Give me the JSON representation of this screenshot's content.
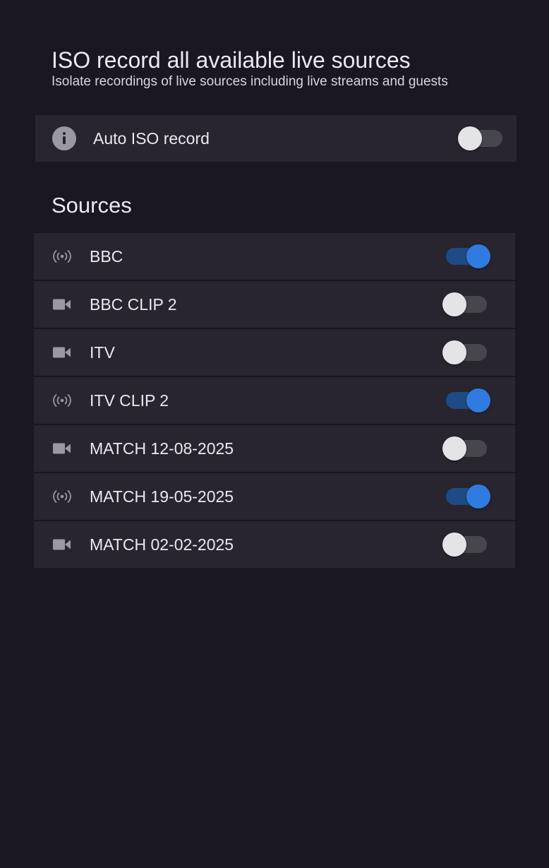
{
  "header": {
    "title": "ISO record all available live sources",
    "subtitle": "Isolate recordings of live sources including live streams and guests"
  },
  "auto_iso": {
    "icon": "info-icon",
    "label": "Auto ISO record",
    "enabled": false
  },
  "sources": {
    "heading": "Sources",
    "items": [
      {
        "label": "BBC",
        "icon": "broadcast-icon",
        "enabled": true
      },
      {
        "label": "BBC CLIP 2",
        "icon": "video-camera-icon",
        "enabled": false
      },
      {
        "label": "ITV",
        "icon": "video-camera-icon",
        "enabled": false
      },
      {
        "label": "ITV CLIP 2",
        "icon": "broadcast-icon",
        "enabled": true
      },
      {
        "label": "MATCH 12-08-2025",
        "icon": "video-camera-icon",
        "enabled": false
      },
      {
        "label": "MATCH 19-05-2025",
        "icon": "broadcast-icon",
        "enabled": true
      },
      {
        "label": "MATCH 02-02-2025",
        "icon": "video-camera-icon",
        "enabled": false
      }
    ]
  },
  "colors": {
    "background": "#1a1622",
    "row_background": "#28252f",
    "toggle_on": "#2f7be0",
    "toggle_on_track": "#1f4a86",
    "toggle_off_knob": "#e4e3e6",
    "toggle_off_track": "#47454d",
    "icon": "#9a98a0"
  }
}
